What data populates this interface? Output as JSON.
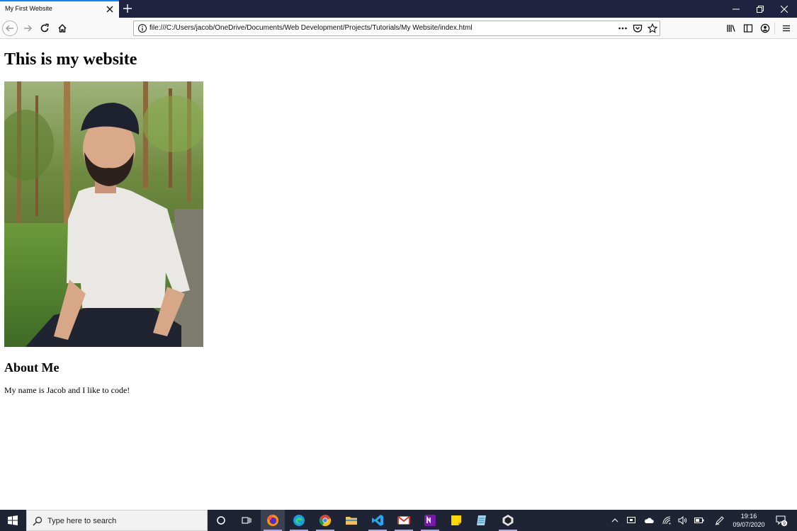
{
  "browser": {
    "tab_title": "My First Website",
    "url": "file:///C:/Users/jacob/OneDrive/Documents/Web Development/Projects/Tutorials/My Website/index.html"
  },
  "page": {
    "heading": "This is my website",
    "image_alt": "",
    "subheading": "About Me",
    "paragraph": "My name is Jacob and I like to code!"
  },
  "taskbar": {
    "search_placeholder": "Type here to search",
    "pinned_apps": [
      "cortana-icon",
      "task-view-icon",
      "firefox-icon",
      "edge-icon",
      "chrome-icon",
      "file-explorer-icon",
      "vscode-icon",
      "mail-icon",
      "onenote-icon",
      "sticky-notes-icon",
      "notepad-icon",
      "unity-icon"
    ],
    "clock": {
      "time": "19:16",
      "date": "09/07/2020"
    },
    "notification_count": "9"
  },
  "colors": {
    "tabbar_bg": "#202340",
    "tab_accent": "#0a84ff",
    "toolbar_bg": "#f9f9fa",
    "taskbar_bg": "#1e2434"
  }
}
